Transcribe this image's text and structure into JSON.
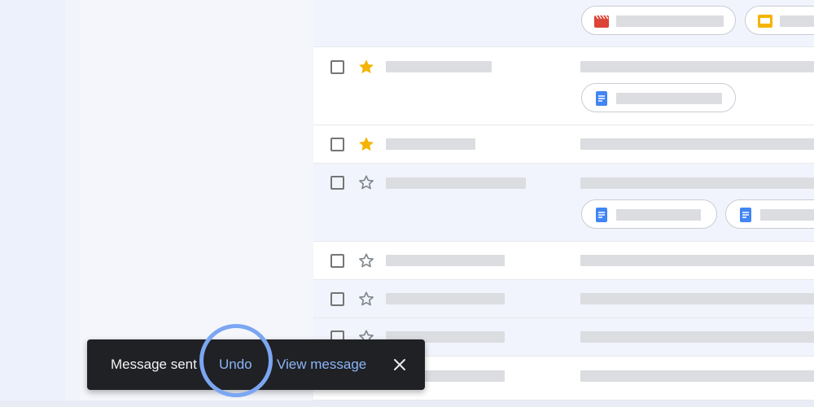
{
  "snackbar": {
    "message": "Message sent",
    "undo_label": "Undo",
    "view_label": "View message",
    "close_icon": "close-icon"
  },
  "mail_rows": [
    {
      "starred": null,
      "attachments": [
        "video-icon",
        "slides-icon"
      ]
    },
    {
      "starred": true,
      "attachments": [
        "docs-icon"
      ]
    },
    {
      "starred": true,
      "attachments": []
    },
    {
      "starred": false,
      "attachments": [
        "docs-icon",
        "docs-icon"
      ]
    },
    {
      "starred": false,
      "attachments": []
    },
    {
      "starred": false,
      "attachments": []
    },
    {
      "starred": false,
      "attachments": []
    },
    {
      "starred": false,
      "attachments": []
    }
  ],
  "colors": {
    "accent": "#8ab4f8",
    "highlight_ring": "#7ba6f2",
    "star_filled": "#f4b400",
    "docs_blue": "#4285f4",
    "video_red": "#db4437",
    "slides_yellow": "#f4b400",
    "snackbar_bg": "#202124"
  }
}
